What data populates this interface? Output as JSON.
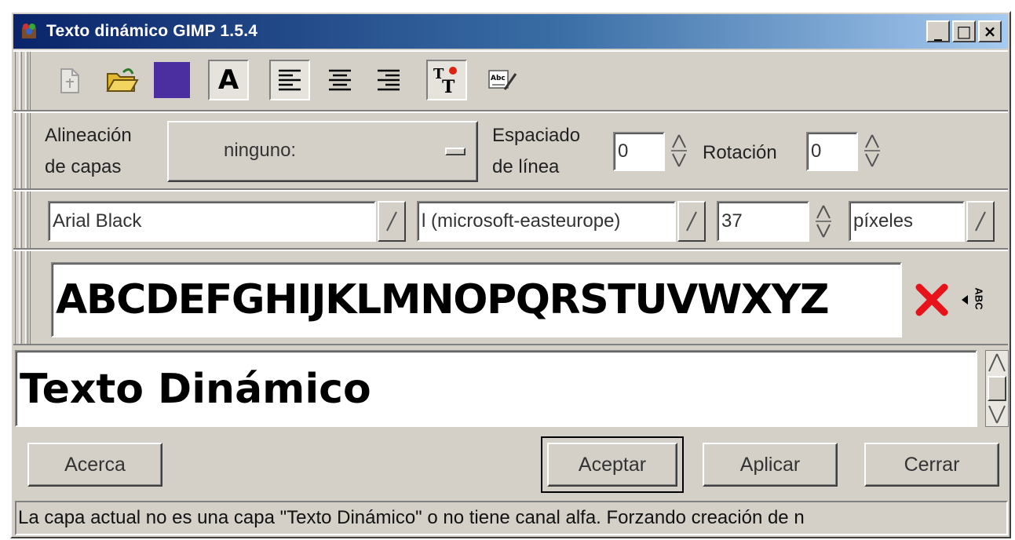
{
  "window": {
    "title": "Texto dinámico GIMP 1.5.4",
    "controls": {
      "minimize": "_",
      "maximize": "□",
      "close": "×"
    }
  },
  "toolbar": {
    "icons": [
      "new-layer-icon",
      "open-folder-icon",
      "color-swatch-icon",
      "antialias-icon",
      "align-left-icon",
      "align-center-icon",
      "align-right-icon",
      "text-layer-icon",
      "spellcheck-icon"
    ],
    "color": "#4b2fa0",
    "antialias_label": "A"
  },
  "layer_alignment": {
    "label_line1": "Alineación",
    "label_line2": "de capas",
    "selected": "ninguno:"
  },
  "line_spacing": {
    "label_line1": "Espaciado",
    "label_line2": "de línea",
    "value": "0"
  },
  "rotation": {
    "label": "Rotación",
    "value": "0"
  },
  "font": {
    "family": "Arial Black",
    "encoding": "l (microsoft-easteurope)",
    "size": "37",
    "unit": "píxeles"
  },
  "preview": {
    "sample": "ABCDEFGHIJKLMNOPQRSTUVWXYZ",
    "abc_label": "ABC",
    "clear_color": "#e8121a"
  },
  "text": {
    "content": "Texto Dinámico"
  },
  "buttons": {
    "about": "Acerca",
    "ok": "Aceptar",
    "apply": "Aplicar",
    "close": "Cerrar"
  },
  "status": {
    "message": "La capa actual no es una capa \"Texto Dinámico\" o no tiene canal alfa. Forzando creación de n"
  }
}
